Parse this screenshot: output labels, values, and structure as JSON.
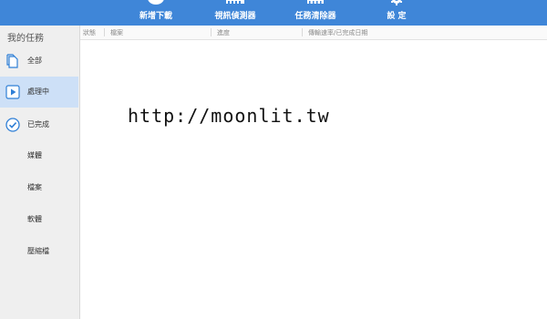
{
  "toolbar": {
    "items": [
      {
        "label": "新增下載",
        "icon": "plus-circle-icon"
      },
      {
        "label": "視訊偵測器",
        "icon": "film-strip-icon"
      },
      {
        "label": "任務清除器",
        "icon": "broom-icon"
      },
      {
        "label": "設 定",
        "icon": "gear-icon"
      }
    ],
    "background": "#3f86d8"
  },
  "sidebar": {
    "title": "我的任務",
    "items": [
      {
        "label": "全部",
        "icon": "document-icon"
      },
      {
        "label": "處理中",
        "icon": "play-icon"
      },
      {
        "label": "已完成",
        "icon": "check-circle-icon"
      }
    ],
    "sub_items": [
      {
        "label": "媒體"
      },
      {
        "label": "檔案"
      },
      {
        "label": "軟體"
      },
      {
        "label": "壓縮檔"
      }
    ],
    "active_color": "#cde0f7"
  },
  "columns": [
    {
      "label": "狀態"
    },
    {
      "label": "檔案"
    },
    {
      "label": "進度"
    },
    {
      "label": "傳輸速率/已完成日期"
    }
  ],
  "main": {
    "watermark": "http://moonlit.tw"
  }
}
